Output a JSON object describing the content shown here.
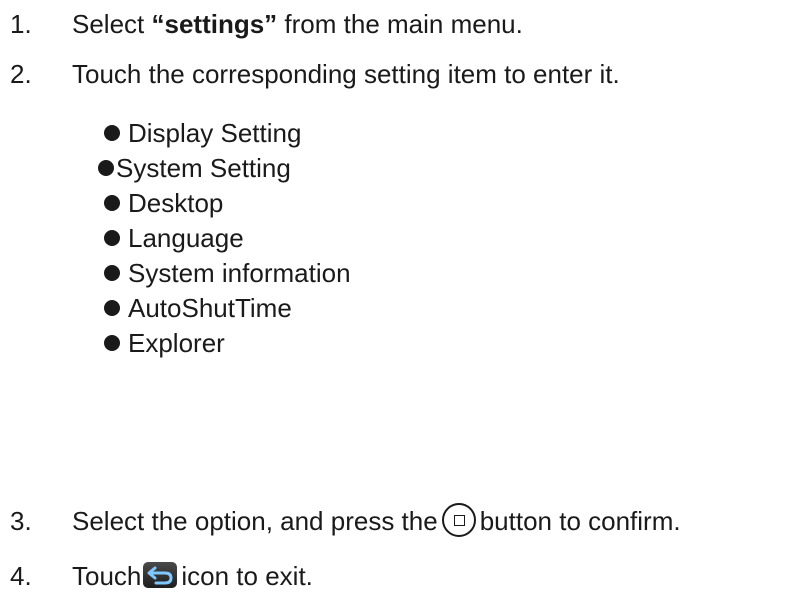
{
  "steps": [
    {
      "num": "1.",
      "prefix": "Select ",
      "bold": "“settings”",
      "suffix": " from the main menu."
    },
    {
      "num": "2.",
      "text": "Touch the corresponding setting item to enter it."
    },
    {
      "num": "3.",
      "prefix": "Select the option, and press the",
      "suffix": "button to confirm."
    },
    {
      "num": "4.",
      "prefix": "Touch",
      "suffix": "icon to exit."
    }
  ],
  "settings_items": [
    "Display Setting",
    "System Setting",
    "Desktop",
    "Language",
    "System information",
    "AutoShutTime",
    "Explorer"
  ],
  "icons": {
    "confirm_button": "home-button-icon",
    "exit": "back-arrow-icon"
  }
}
